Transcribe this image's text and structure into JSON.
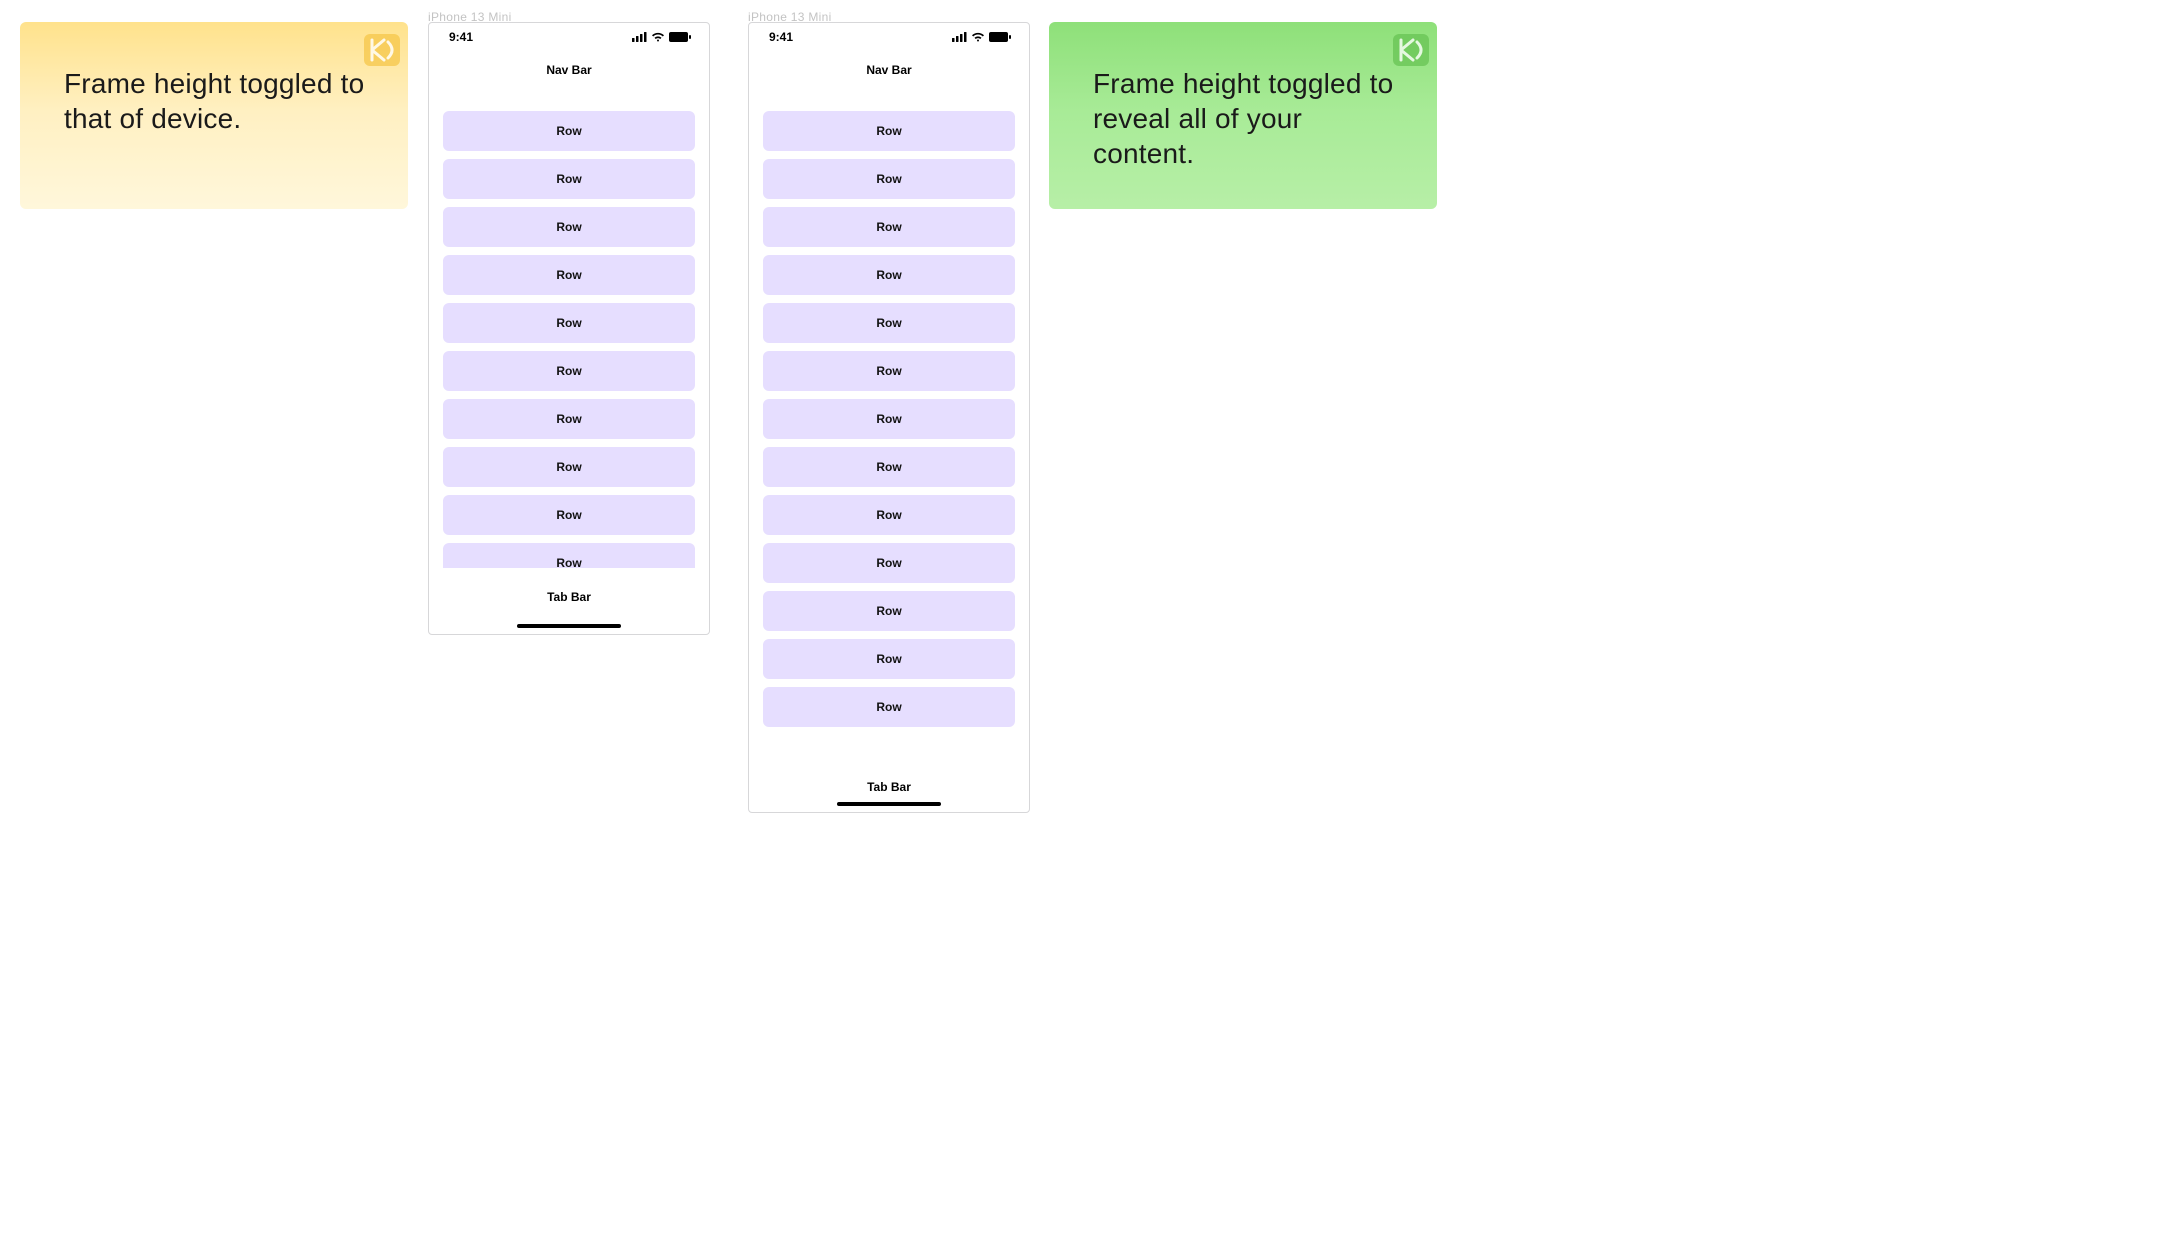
{
  "callouts": {
    "left": "Frame height toggled to that of device.",
    "right": "Frame height toggled to reveal all of your content."
  },
  "frame_label": "iPhone 13 Mini",
  "status": {
    "time": "9:41"
  },
  "nav_bar_label": "Nav Bar",
  "tab_bar_label": "Tab Bar",
  "row_label": "Row",
  "row_counts": {
    "device_clipped": 10,
    "device_expanded": 13
  },
  "colors": {
    "row_bg": "#e6deff",
    "callout_yellow": "#ffe28c",
    "callout_green": "#8ee079"
  }
}
